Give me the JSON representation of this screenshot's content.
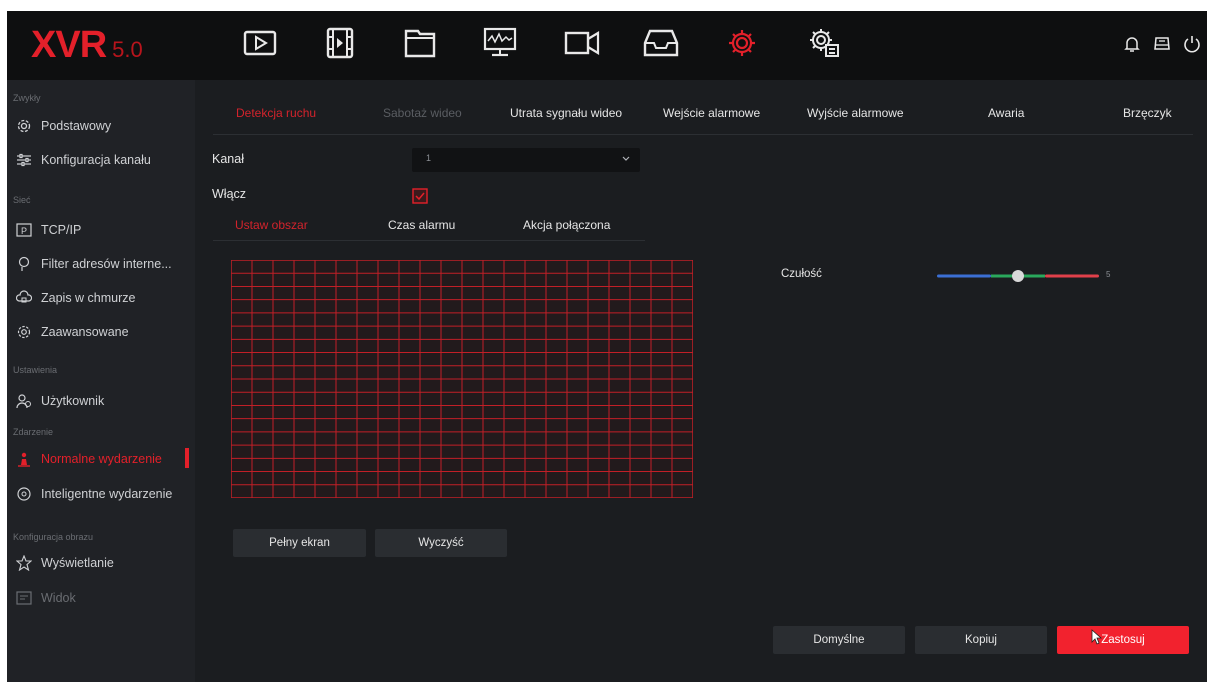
{
  "app": {
    "logo_main": "XVR",
    "logo_version": "5.0"
  },
  "topbar": {
    "icons": [
      "playback-icon",
      "video-clip-icon",
      "file-folder-icon",
      "system-monitor-icon",
      "camera-icon",
      "storage-tray-icon",
      "settings-gear-icon",
      "maintenance-gear-icon"
    ],
    "active_icon": "settings-gear-icon",
    "right_icons": [
      "bell-icon",
      "hdd-icon",
      "power-icon"
    ],
    "accent": "#e3202a"
  },
  "sidebar": {
    "sections": [
      {
        "label": "Zwykły",
        "items": [
          {
            "label": "Podstawowy",
            "icon": "gear-icon"
          },
          {
            "label": "Konfiguracja kanału",
            "icon": "sliders-icon"
          }
        ]
      },
      {
        "label": "Sieć",
        "items": [
          {
            "label": "TCP/IP",
            "icon": "tcpip-icon"
          },
          {
            "label": "Filter adresów interne...",
            "icon": "filter-icon"
          },
          {
            "label": "Zapis w chmurze",
            "icon": "cloud-icon"
          },
          {
            "label": "Zaawansowane",
            "icon": "advanced-gear-icon"
          }
        ]
      },
      {
        "label": "Ustawienia",
        "items": [
          {
            "label": "Użytkownik",
            "icon": "user-icon"
          }
        ]
      },
      {
        "label": "Zdarzenie",
        "items": [
          {
            "label": "Normalne wydarzenie",
            "icon": "alarm-person-icon",
            "active": true
          },
          {
            "label": "Inteligentne wydarzenie",
            "icon": "smart-event-icon"
          }
        ]
      },
      {
        "label": "Konfiguracja obrazu",
        "items": [
          {
            "label": "Wyświetlanie",
            "icon": "star-icon"
          },
          {
            "label": "Widok",
            "icon": "view-icon",
            "dim": true
          }
        ]
      }
    ]
  },
  "main": {
    "tabs": [
      {
        "label": "Detekcja ruchu",
        "state": "active"
      },
      {
        "label": "Sabotaż wideo",
        "state": "disabled"
      },
      {
        "label": "Utrata sygnału wideo",
        "state": "normal"
      },
      {
        "label": "Wejście alarmowe",
        "state": "normal"
      },
      {
        "label": "Wyjście alarmowe",
        "state": "normal"
      },
      {
        "label": "Awaria",
        "state": "normal"
      },
      {
        "label": "Brzęczyk",
        "state": "normal"
      }
    ],
    "channel_label": "Kanał",
    "channel_value": "1",
    "enable_label": "Włącz",
    "enable_checked": true,
    "subtabs": [
      {
        "label": "Ustaw obszar",
        "state": "active"
      },
      {
        "label": "Czas alarmu",
        "state": "normal"
      },
      {
        "label": "Akcja połączona",
        "state": "normal"
      }
    ],
    "grid": {
      "cols": 22,
      "rows": 18,
      "color": "#c21f27"
    },
    "sensitivity_label": "Czułość",
    "sensitivity_value": "5",
    "sensitivity_level": 0.5,
    "fullscreen_label": "Pełny ekran",
    "clear_label": "Wyczyść",
    "default_label": "Domyślne",
    "copy_label": "Kopiuj",
    "apply_label": "Zastosuj"
  }
}
